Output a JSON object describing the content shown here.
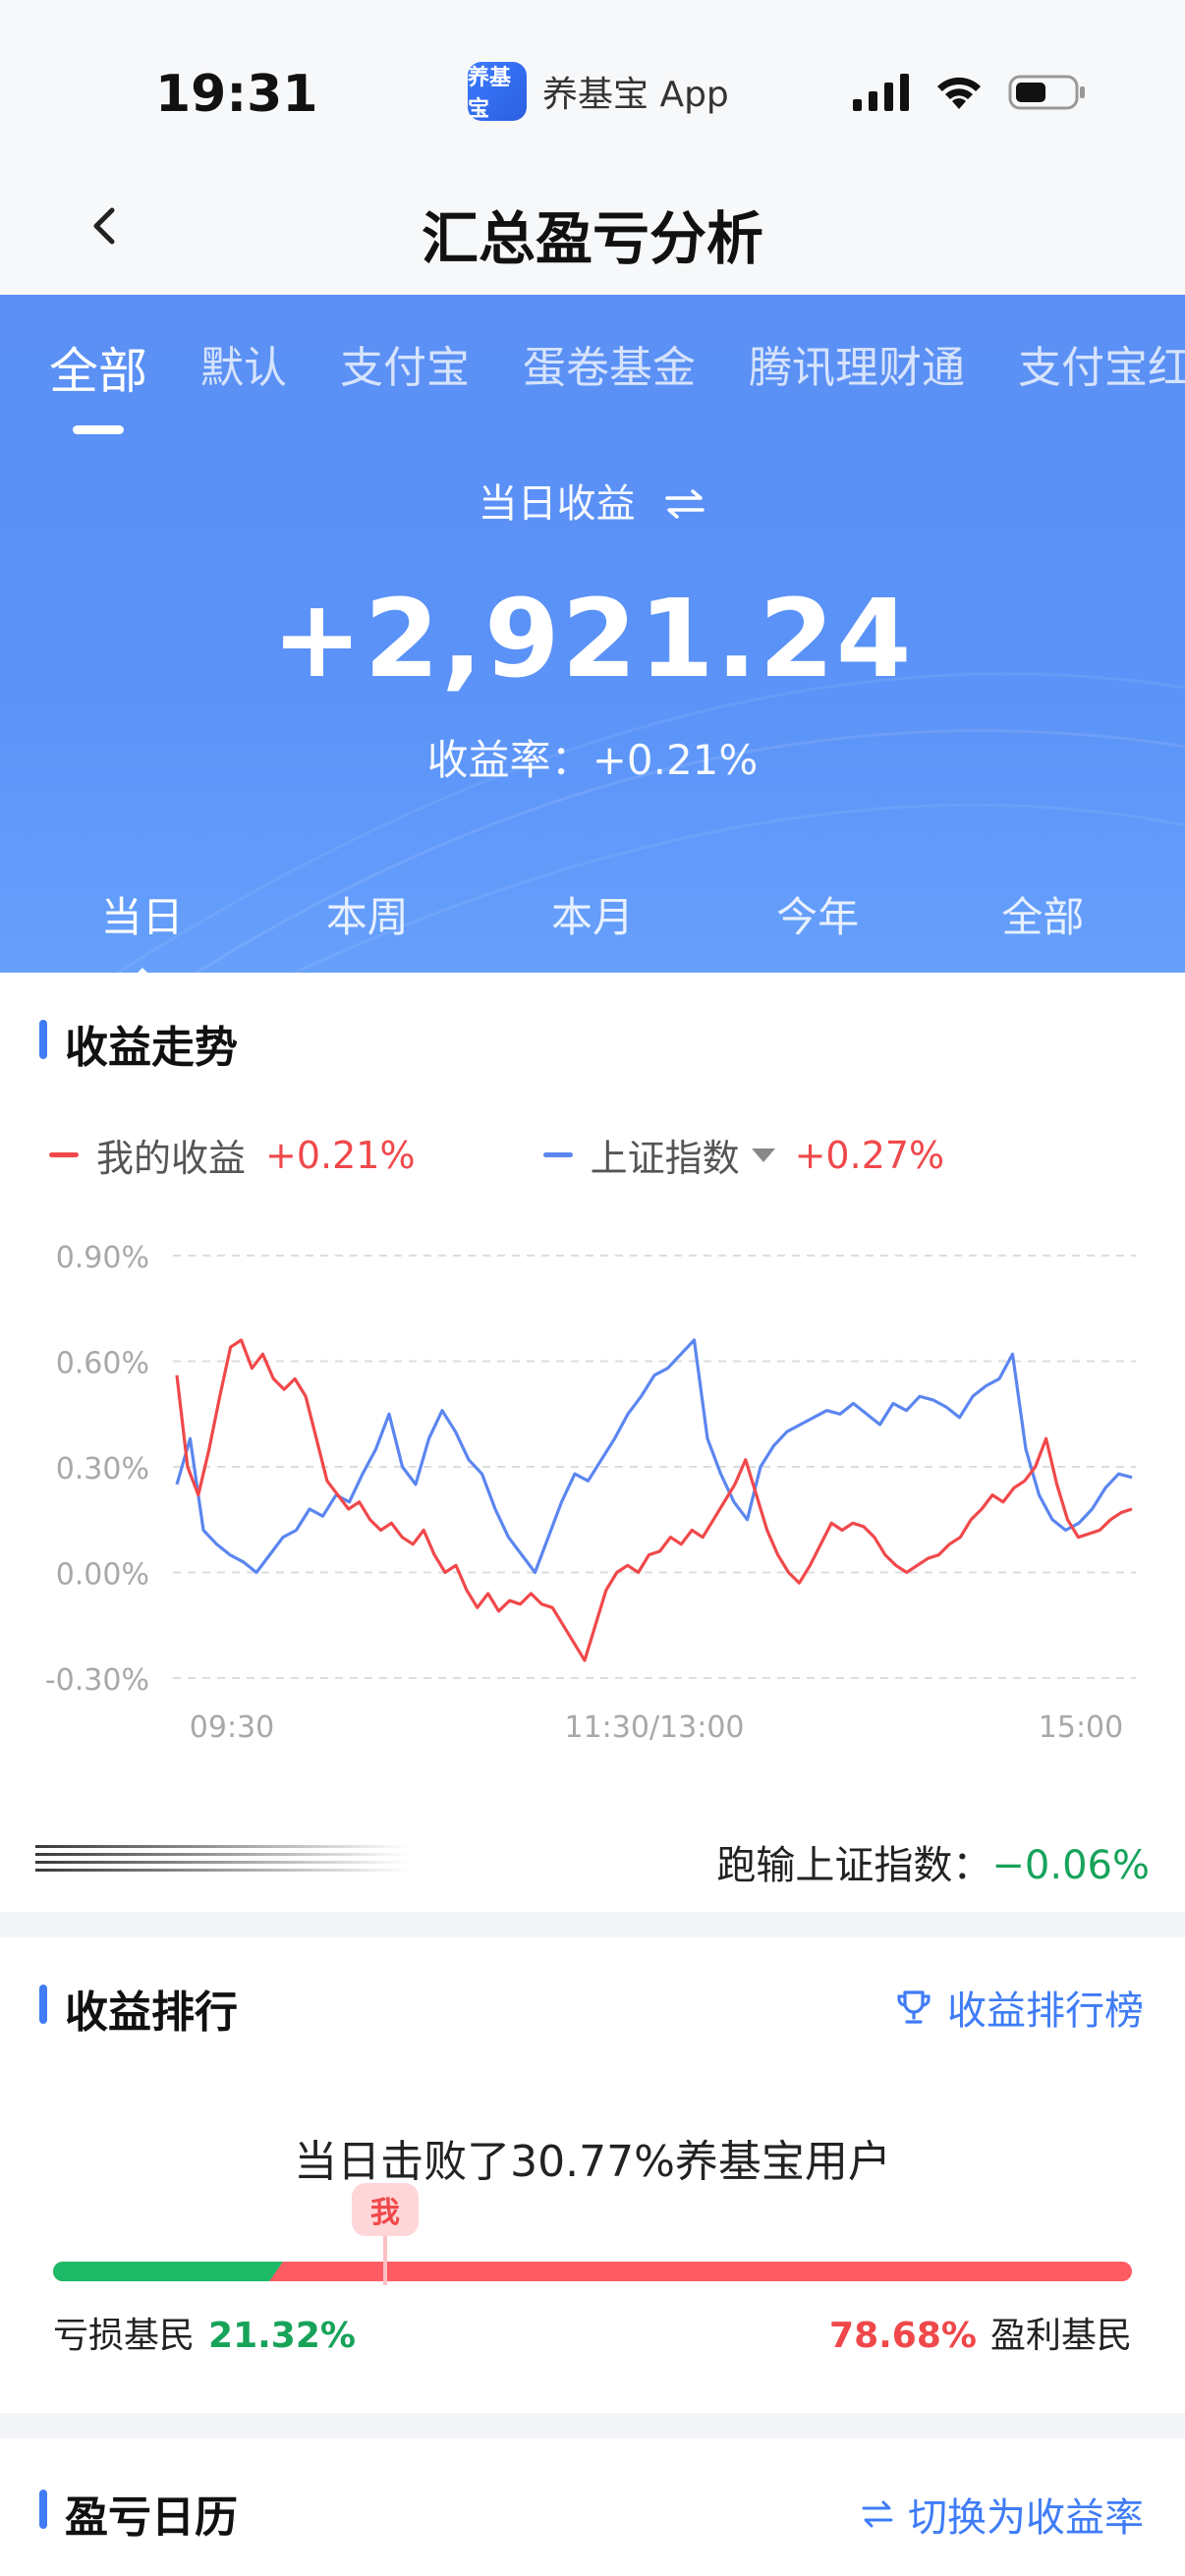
{
  "status_bar": {
    "time": "19:31",
    "app_name": "养基宝 App",
    "app_logo_text": "养基宝"
  },
  "nav": {
    "title": "汇总盈亏分析"
  },
  "account_tabs": [
    "全部",
    "默认",
    "支付宝",
    "蛋卷基金",
    "腾讯理财通",
    "支付宝红"
  ],
  "summary": {
    "label": "当日收益",
    "switch_icon": "swap-icon",
    "value": "+2,921.24",
    "rate_label": "收益率：",
    "rate_value": "+0.21%"
  },
  "periods": [
    "当日",
    "本周",
    "本月",
    "今年",
    "全部"
  ],
  "trend": {
    "title": "收益走势",
    "legend": [
      {
        "name": "我的收益",
        "value": "+0.21%",
        "color": "#f0484a"
      },
      {
        "name": "上证指数",
        "value": "+0.27%",
        "color": "#5b86f0"
      }
    ],
    "lose_label": "跑输上证指数：",
    "lose_value": "−0.06%"
  },
  "chart_data": {
    "type": "line",
    "x_ticks": [
      "09:30",
      "11:30/13:00",
      "15:00"
    ],
    "y_ticks": [
      "0.90%",
      "0.60%",
      "0.30%",
      "0.00%",
      "-0.30%"
    ],
    "ylim": [
      -0.3,
      0.9
    ],
    "series": [
      {
        "name": "我的收益",
        "color": "#f0484a",
        "values": [
          0.56,
          0.3,
          0.22,
          0.35,
          0.5,
          0.64,
          0.66,
          0.58,
          0.62,
          0.55,
          0.52,
          0.55,
          0.5,
          0.38,
          0.26,
          0.22,
          0.18,
          0.2,
          0.15,
          0.12,
          0.14,
          0.1,
          0.08,
          0.12,
          0.05,
          0.0,
          0.02,
          -0.05,
          -0.1,
          -0.06,
          -0.11,
          -0.08,
          -0.09,
          -0.06,
          -0.09,
          -0.1,
          -0.15,
          -0.2,
          -0.25,
          -0.15,
          -0.05,
          0.0,
          0.02,
          0.0,
          0.05,
          0.06,
          0.1,
          0.08,
          0.12,
          0.1,
          0.15,
          0.2,
          0.25,
          0.32,
          0.22,
          0.12,
          0.05,
          0.0,
          -0.03,
          0.02,
          0.08,
          0.14,
          0.12,
          0.14,
          0.13,
          0.1,
          0.05,
          0.02,
          0.0,
          0.02,
          0.04,
          0.05,
          0.08,
          0.1,
          0.15,
          0.18,
          0.22,
          0.2,
          0.24,
          0.26,
          0.3,
          0.38,
          0.25,
          0.15,
          0.1,
          0.11,
          0.12,
          0.15,
          0.17,
          0.18
        ]
      },
      {
        "name": "上证指数",
        "color": "#5b86f0",
        "values": [
          0.25,
          0.38,
          0.12,
          0.08,
          0.05,
          0.03,
          0.0,
          0.05,
          0.1,
          0.12,
          0.18,
          0.16,
          0.22,
          0.2,
          0.28,
          0.35,
          0.45,
          0.3,
          0.25,
          0.38,
          0.46,
          0.4,
          0.32,
          0.28,
          0.18,
          0.1,
          0.05,
          0.0,
          0.1,
          0.2,
          0.28,
          0.26,
          0.32,
          0.38,
          0.45,
          0.5,
          0.56,
          0.58,
          0.62,
          0.66,
          0.38,
          0.28,
          0.2,
          0.15,
          0.3,
          0.36,
          0.4,
          0.42,
          0.44,
          0.46,
          0.45,
          0.48,
          0.45,
          0.42,
          0.48,
          0.46,
          0.5,
          0.49,
          0.47,
          0.44,
          0.5,
          0.53,
          0.55,
          0.62,
          0.35,
          0.22,
          0.15,
          0.12,
          0.14,
          0.18,
          0.24,
          0.28,
          0.27
        ]
      }
    ]
  },
  "ranking": {
    "title": "收益排行",
    "link_label": "收益排行榜",
    "link_icon": "trophy-icon",
    "sentence": "当日击败了30.77%养基宝用户",
    "me_label": "我",
    "loss_fraction": 0.2132,
    "me_fraction": 0.3077,
    "left_label": "亏损基民",
    "left_value": "21.32%",
    "right_value": "78.68%",
    "right_label": "盈利基民"
  },
  "calendar": {
    "title": "盈亏日历",
    "switch_label": "切换为收益率",
    "switch_icon": "swap-icon"
  }
}
